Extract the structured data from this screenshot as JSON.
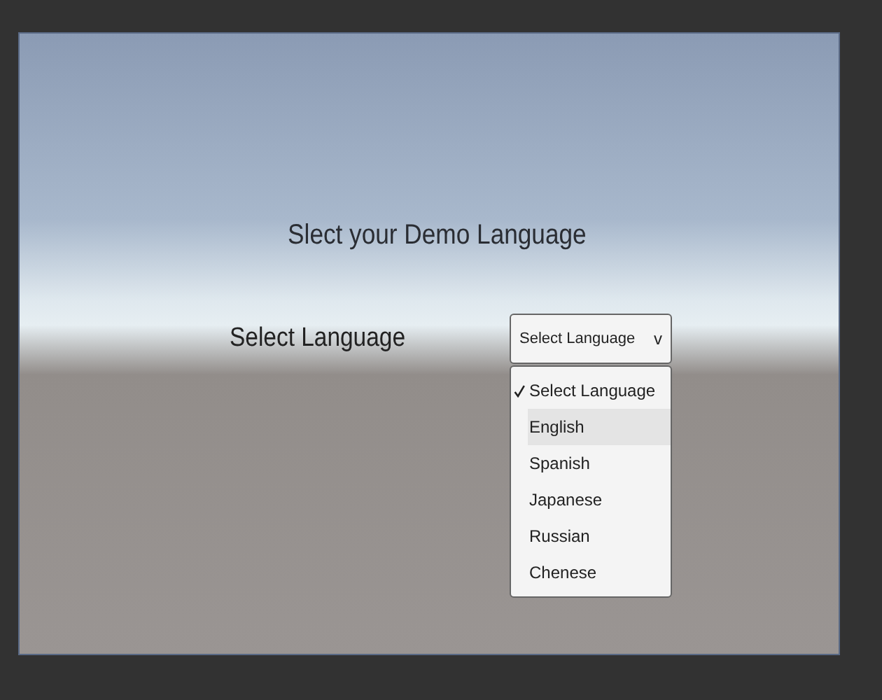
{
  "heading": "Slect your Demo Language",
  "field_label": "Select Language",
  "dropdown": {
    "value": "Select Language",
    "caret": "v",
    "expanded": true,
    "options": [
      {
        "label": "Select Language",
        "selected": true,
        "hovered": false
      },
      {
        "label": "English",
        "selected": false,
        "hovered": true
      },
      {
        "label": "Spanish",
        "selected": false,
        "hovered": false
      },
      {
        "label": "Japanese",
        "selected": false,
        "hovered": false
      },
      {
        "label": "Russian",
        "selected": false,
        "hovered": false
      },
      {
        "label": "Chenese",
        "selected": false,
        "hovered": false
      }
    ]
  }
}
